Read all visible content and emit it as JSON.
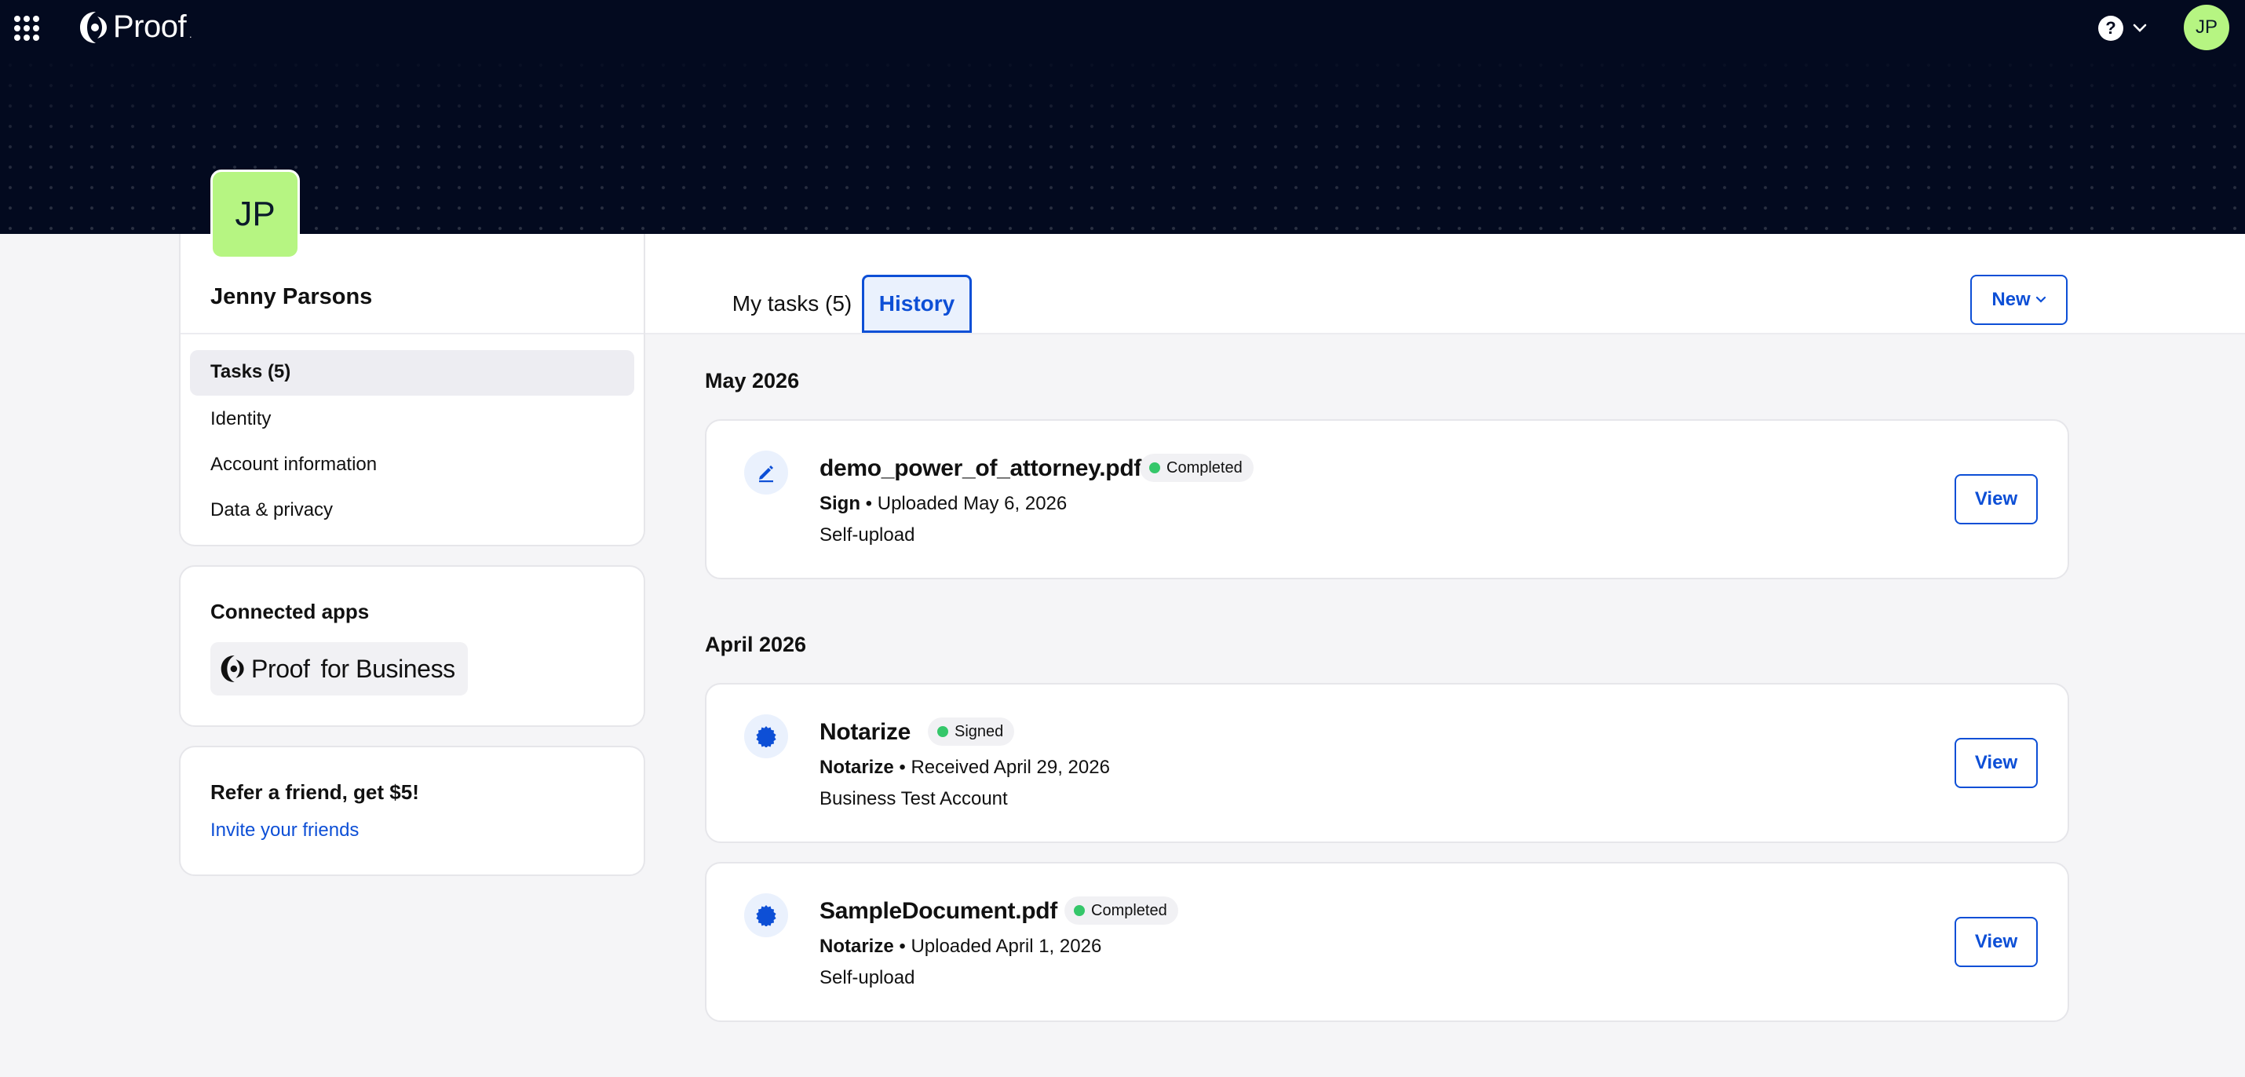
{
  "header": {
    "logo_text": "Proof",
    "user_initials": "JP",
    "help_label": "?"
  },
  "profile": {
    "initials": "JP",
    "name": "Jenny Parsons",
    "menu": [
      {
        "label": "Tasks (5)",
        "active": true
      },
      {
        "label": "Identity",
        "active": false
      },
      {
        "label": "Account information",
        "active": false
      },
      {
        "label": "Data & privacy",
        "active": false
      }
    ]
  },
  "connected_apps": {
    "title": "Connected apps",
    "app_name": "Proof",
    "app_suffix": "for Business"
  },
  "refer": {
    "title": "Refer a friend, get $5!",
    "link": "Invite your friends"
  },
  "tabs": [
    {
      "label": "My tasks (5)",
      "active": false
    },
    {
      "label": "History",
      "active": true
    }
  ],
  "new_button": "New",
  "history": [
    {
      "month": "May 2026",
      "items": [
        {
          "title": "demo_power_of_attorney.pdf",
          "status": "Completed",
          "type": "Sign",
          "detail": "Uploaded May 6, 2026",
          "source": "Self-upload",
          "icon": "pen-icon",
          "action": "View"
        }
      ]
    },
    {
      "month": "April 2026",
      "items": [
        {
          "title": "Notarize",
          "status": "Signed",
          "type": "Notarize",
          "detail": "Received April 29, 2026",
          "source": "Business Test Account",
          "icon": "seal-icon",
          "action": "View"
        },
        {
          "title": "SampleDocument.pdf",
          "status": "Completed",
          "type": "Notarize",
          "detail": "Uploaded April 1, 2026",
          "source": "Self-upload",
          "icon": "seal-icon",
          "action": "View"
        }
      ]
    }
  ],
  "colors": {
    "accent": "#0d4fd6",
    "banner": "#030a1f",
    "avatar": "#b6f582",
    "status_green": "#35c76a"
  }
}
